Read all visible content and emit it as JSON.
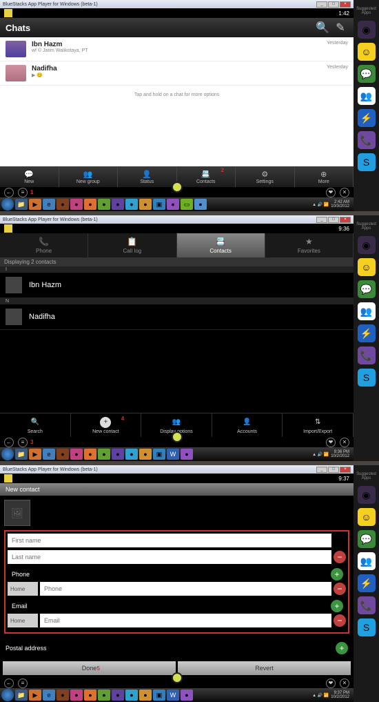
{
  "window_title": "BlueStacks App Player for Windows (beta-1)",
  "sidebar_label": "Suggested Apps",
  "times": {
    "s1": "1:42",
    "s2": "9:36",
    "s3": "9:37"
  },
  "tray": {
    "t1": "2:42 AM",
    "d1": "10/3/2012",
    "t2": "9:36 PM",
    "d2": "10/2/2012",
    "t3": "9:37 PM",
    "d3": "10/2/2012"
  },
  "chats": {
    "title": "Chats",
    "items": [
      {
        "name": "Ibn Hazm",
        "sub": "wf © Jatim Walikotaya, PT",
        "time": "Yesterday"
      },
      {
        "name": "Nadifha",
        "sub": "▶ 😊",
        "time": "Yesterday"
      }
    ],
    "hint": "Tap and hold on a chat for more options"
  },
  "nav": {
    "new": "New",
    "newgroup": "New group",
    "status": "Status",
    "contacts": "Contacts",
    "settings": "Settings",
    "more": "More"
  },
  "tabs": {
    "phone": "Phone",
    "calllog": "Call log",
    "contacts": "Contacts",
    "favorites": "Favorites"
  },
  "contacts_screen": {
    "header": "Displaying 2 contacts",
    "letter_i": "I",
    "letter_n": "N",
    "c1": "Ibn Hazm",
    "c2": "Nadifha"
  },
  "actions": {
    "search": "Search",
    "newcontact": "New contact",
    "display": "Display options",
    "accounts": "Accounts",
    "impexp": "Import/Export"
  },
  "newcontact": {
    "title": "New contact",
    "first": "First name",
    "last": "Last name",
    "phone_label": "Phone",
    "phone_type": "Home",
    "phone_ph": "Phone",
    "email_label": "Email",
    "email_type": "Home",
    "email_ph": "Email",
    "postal": "Postal address",
    "done": "Done",
    "revert": "Revert"
  },
  "nums": {
    "n1": "1",
    "n2": "2",
    "n3": "3",
    "n4": "4",
    "n5": "5"
  }
}
